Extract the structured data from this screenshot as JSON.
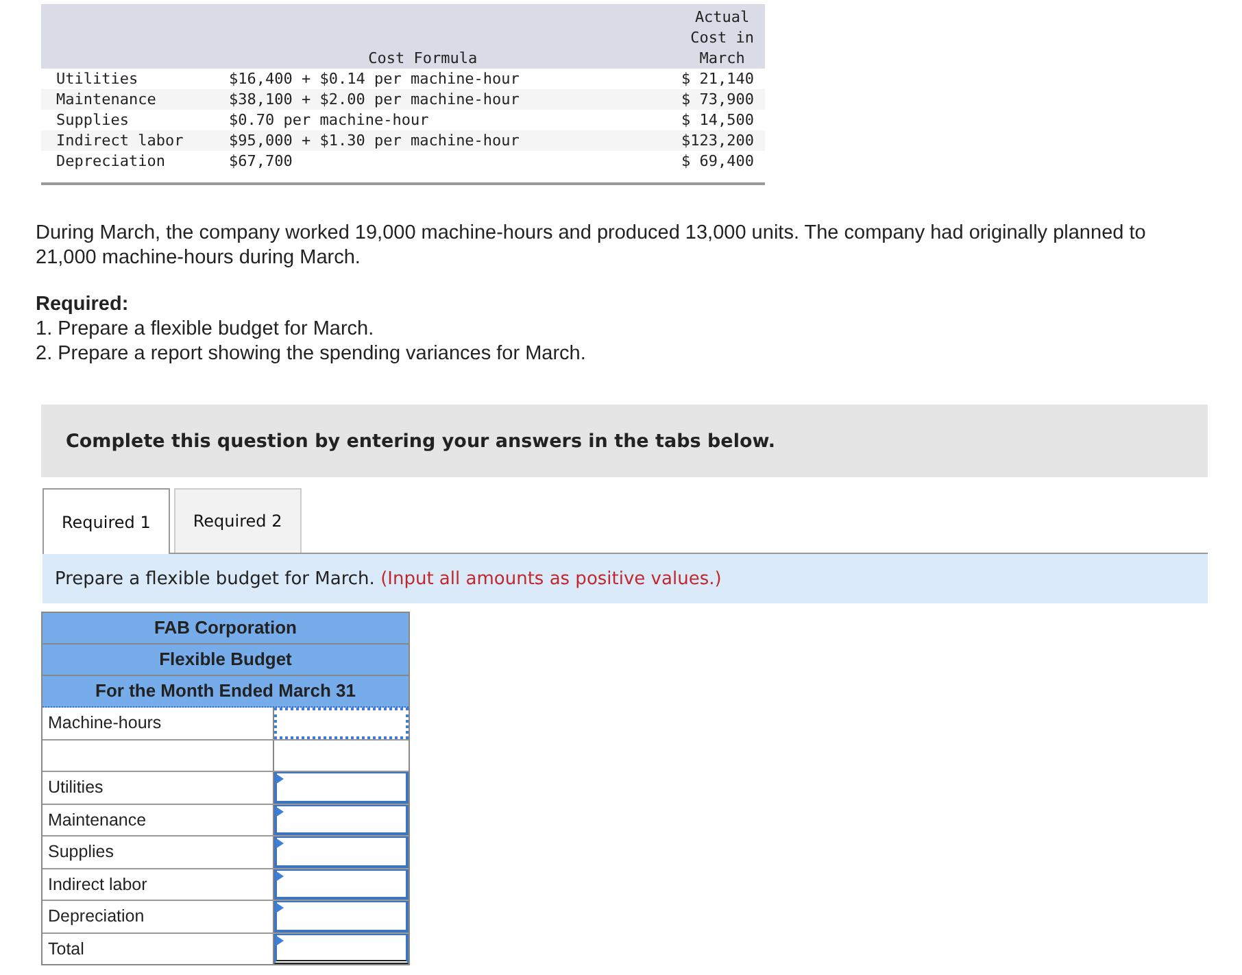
{
  "cost_table": {
    "columns": [
      "",
      "Cost Formula",
      "Actual\nCost in\nMarch"
    ],
    "rows": [
      {
        "item": "Utilities",
        "formula": "$16,400 + $0.14 per machine-hour",
        "actual": "$ 21,140"
      },
      {
        "item": "Maintenance",
        "formula": "$38,100 + $2.00 per machine-hour",
        "actual": "$ 73,900"
      },
      {
        "item": "Supplies",
        "formula": "$0.70 per machine-hour",
        "actual": "$ 14,500"
      },
      {
        "item": "Indirect labor",
        "formula": "$95,000 + $1.30 per machine-hour",
        "actual": "$123,200"
      },
      {
        "item": "Depreciation",
        "formula": "$67,700",
        "actual": "$ 69,400"
      }
    ]
  },
  "intro": [
    "During March, the company worked 19,000 machine-hours and produced 13,000 units. The company had originally planned to",
    "21,000 machine-hours during March."
  ],
  "required_heading": "Required:",
  "requirements": [
    "1. Prepare a flexible budget for March.",
    "2. Prepare a report showing the spending variances for March."
  ],
  "instruction_banner": "Complete this question by entering your answers in the tabs below.",
  "tabs": [
    {
      "label": "Required 1",
      "selected": true
    },
    {
      "label": "Required 2",
      "selected": false
    }
  ],
  "prompt": {
    "text": "Prepare a flexible budget for March.",
    "note": "(Input all amounts as positive values.)"
  },
  "budget": {
    "titles": [
      "FAB Corporation",
      "Flexible Budget",
      "For the Month Ended March 31"
    ],
    "rows": [
      {
        "kind": "hours",
        "label": "Machine-hours"
      },
      {
        "kind": "blank"
      },
      {
        "kind": "entry",
        "label": "Utilities"
      },
      {
        "kind": "entry",
        "label": "Maintenance"
      },
      {
        "kind": "entry",
        "label": "Supplies"
      },
      {
        "kind": "entry",
        "label": "Indirect labor"
      },
      {
        "kind": "entry",
        "label": "Depreciation"
      },
      {
        "kind": "total",
        "label": "Total"
      }
    ]
  }
}
